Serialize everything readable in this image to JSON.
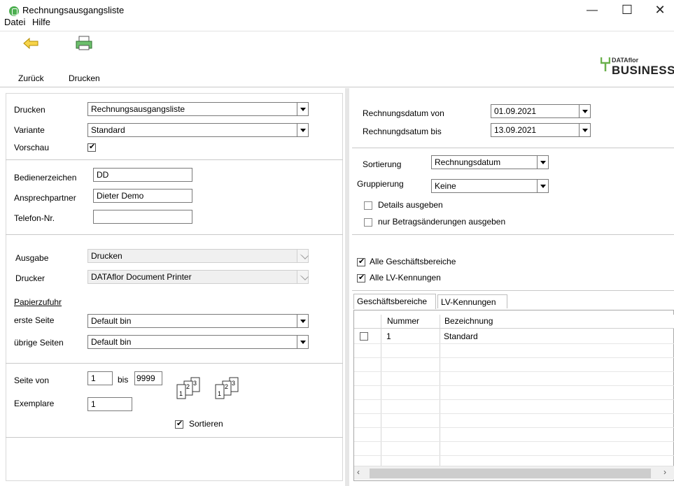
{
  "window": {
    "title": "Rechnungsausgangsliste"
  },
  "menu": {
    "items": [
      "Datei",
      "Hilfe"
    ]
  },
  "toolbar": {
    "back_label": "Zurück",
    "print_label": "Drucken"
  },
  "logo": {
    "brand_small": "DATAflor",
    "brand_big": "BUSINESS"
  },
  "left": {
    "drucken_label": "Drucken",
    "drucken_value": "Rechnungsausgangsliste",
    "variante_label": "Variante",
    "variante_value": "Standard",
    "vorschau_label": "Vorschau",
    "bediener_label": "Bedienerzeichen",
    "bediener_value": "DD",
    "ansprech_label": "Ansprechpartner",
    "ansprech_value": "Dieter Demo",
    "telefon_label": "Telefon-Nr.",
    "telefon_value": "",
    "ausgabe_label": "Ausgabe",
    "ausgabe_value": "Drucken",
    "drucker_label": "Drucker",
    "drucker_value": "DATAflor Document Printer",
    "papierzufuhr_label": "Papierzufuhr",
    "erste_label": "erste Seite",
    "erste_value": "Default bin",
    "uebrige_label": "übrige Seiten",
    "uebrige_value": "Default bin",
    "seite_von_label": "Seite von",
    "seite_von_value": "1",
    "bis_label": "bis",
    "bis_value": "9999",
    "exemplare_label": "Exemplare",
    "exemplare_value": "1",
    "sortieren_label": "Sortieren"
  },
  "right": {
    "datum_von_label": "Rechnungsdatum von",
    "datum_von_value": "01.09.2021",
    "datum_bis_label": "Rechnungdsatum bis",
    "datum_bis_value": "13.09.2021",
    "sortierung_label": "Sortierung",
    "sortierung_value": "Rechnungsdatum",
    "gruppierung_label": "Gruppierung",
    "gruppierung_value": "Keine",
    "details_label": "Details ausgeben",
    "betrag_label": "nur Betragsänderungen ausgeben",
    "alle_gb_label": "Alle Geschäftsbereiche",
    "alle_lv_label": "Alle LV-Kennungen",
    "tab1": "Geschäftsbereiche",
    "tab2": "LV-Kennungen",
    "grid": {
      "col1": "Nummer",
      "col2": "Bezeichnung",
      "row1_num": "1",
      "row1_name": "Standard"
    }
  },
  "icons": [
    "app-icon",
    "back-arrow-icon",
    "printer-icon",
    "collate-pages-icon",
    "uncollated-pages-icon"
  ]
}
